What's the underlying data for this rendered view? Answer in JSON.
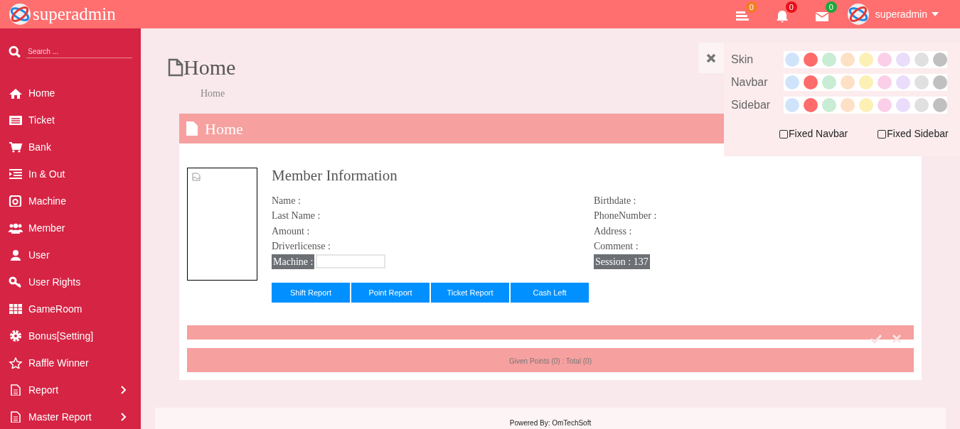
{
  "navbar": {
    "brand": "superadmin",
    "notifications": [
      {
        "kind": "tasks",
        "count": "0",
        "color": "#f57c26"
      },
      {
        "kind": "bell",
        "count": "0",
        "color": "#e8101a"
      },
      {
        "kind": "mail",
        "count": "0",
        "color": "#1da83a"
      }
    ],
    "user": "superadmin"
  },
  "sidebar": {
    "search": {
      "placeholder": "Search ..."
    },
    "items": [
      {
        "label": "Home",
        "has_submenu": false
      },
      {
        "label": "Ticket",
        "has_submenu": false
      },
      {
        "label": "Bank",
        "has_submenu": false
      },
      {
        "label": "In & Out",
        "has_submenu": false
      },
      {
        "label": "Machine",
        "has_submenu": false
      },
      {
        "label": "Member",
        "has_submenu": false
      },
      {
        "label": "User",
        "has_submenu": false
      },
      {
        "label": "User Rights",
        "has_submenu": false
      },
      {
        "label": "GameRoom",
        "has_submenu": false
      },
      {
        "label": "Bonus[Setting]",
        "has_submenu": false
      },
      {
        "label": "Raffle Winner",
        "has_submenu": false
      },
      {
        "label": "Report",
        "has_submenu": true
      },
      {
        "label": "Master Report",
        "has_submenu": true
      }
    ]
  },
  "page_header": {
    "title": "Home",
    "breadcrumb": "Home"
  },
  "panel": {
    "title": "Home",
    "member_info": {
      "title": "Member Information",
      "left_fields": [
        "Name :",
        "Last Name :",
        "Amount :",
        "Driverlicense :"
      ],
      "right_fields": [
        "Birthdate :",
        "PhoneNumber :",
        "Address :",
        "Comment :"
      ],
      "machine_label": "Machine :",
      "session": "Session : 137"
    },
    "buttons": [
      "Shift Report",
      "Point Report",
      "Ticket Report",
      "Cash Left"
    ],
    "summary": "Given Points (0) : Total (0)"
  },
  "settings_panel": {
    "rows": [
      {
        "label": "Skin",
        "swatches": [
          {
            "color": "#cfe4fb"
          },
          {
            "color": "#ff6b6b"
          },
          {
            "color": "#c8ecd4"
          },
          {
            "color": "#fde0c6"
          },
          {
            "color": "#fcf0b4"
          },
          {
            "color": "#fbcfe8"
          },
          {
            "color": "#eadcfb"
          },
          {
            "color": "#e0e0e0"
          },
          {
            "color": "#c0c0c0"
          }
        ]
      },
      {
        "label": "Navbar",
        "swatches": [
          {
            "color": "#cfe4fb"
          },
          {
            "color": "#ff6b6b"
          },
          {
            "color": "#c8ecd4"
          },
          {
            "color": "#fde0c6"
          },
          {
            "color": "#fcf0b4"
          },
          {
            "color": "#fbcfe8"
          },
          {
            "color": "#eadcfb"
          },
          {
            "color": "#e0e0e0"
          },
          {
            "color": "#c0c0c0"
          }
        ]
      },
      {
        "label": "Sidebar",
        "swatches": [
          {
            "color": "#cfe4fb"
          },
          {
            "color": "#ff6b6b"
          },
          {
            "color": "#c8ecd4"
          },
          {
            "color": "#fde0c6"
          },
          {
            "color": "#fcf0b4"
          },
          {
            "color": "#fbcfe8"
          },
          {
            "color": "#eadcfb"
          },
          {
            "color": "#e0e0e0"
          },
          {
            "color": "#c0c0c0"
          }
        ]
      }
    ],
    "checkboxes": [
      {
        "label": "Fixed Navbar",
        "checked": false
      },
      {
        "label": "Fixed Sidebar",
        "checked": false
      }
    ]
  },
  "footer": "Powered By: OmTechSoft"
}
